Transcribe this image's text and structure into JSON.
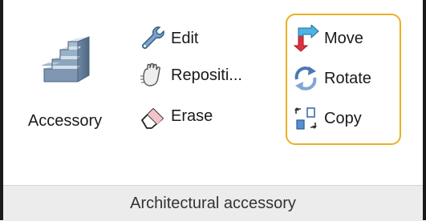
{
  "ribbon": {
    "large_button": {
      "label": "Accessory",
      "icon": "stairs-icon"
    },
    "col1": [
      {
        "label": "Edit",
        "icon": "wrench-icon"
      },
      {
        "label": "Repositi...",
        "icon": "hand-icon"
      },
      {
        "label": "Erase",
        "icon": "eraser-icon"
      }
    ],
    "col2": [
      {
        "label": "Move",
        "icon": "move-arrows-icon"
      },
      {
        "label": "Rotate",
        "icon": "rotate-icon"
      },
      {
        "label": "Copy",
        "icon": "copy-icon"
      }
    ],
    "footer_label": "Architectural accessory",
    "highlight_color": "#e8b122"
  }
}
